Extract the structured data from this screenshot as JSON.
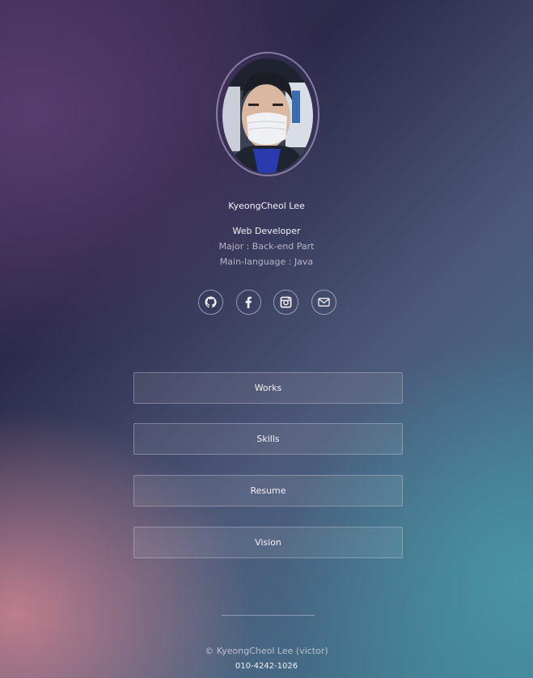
{
  "profile": {
    "name": "KyeongCheol Lee",
    "title": "Web Developer",
    "major": "Major : Back-end Part",
    "language": "Main-language : Java"
  },
  "social": [
    {
      "icon": "github-icon"
    },
    {
      "icon": "facebook-icon"
    },
    {
      "icon": "instagram-icon"
    },
    {
      "icon": "mail-icon"
    }
  ],
  "menu": [
    {
      "label": "Works"
    },
    {
      "label": "Skills"
    },
    {
      "label": "Resume"
    },
    {
      "label": "Vision"
    }
  ],
  "footer": {
    "copyright": "© KyeongCheol Lee (victor)",
    "phone": "010-4242-1026"
  }
}
